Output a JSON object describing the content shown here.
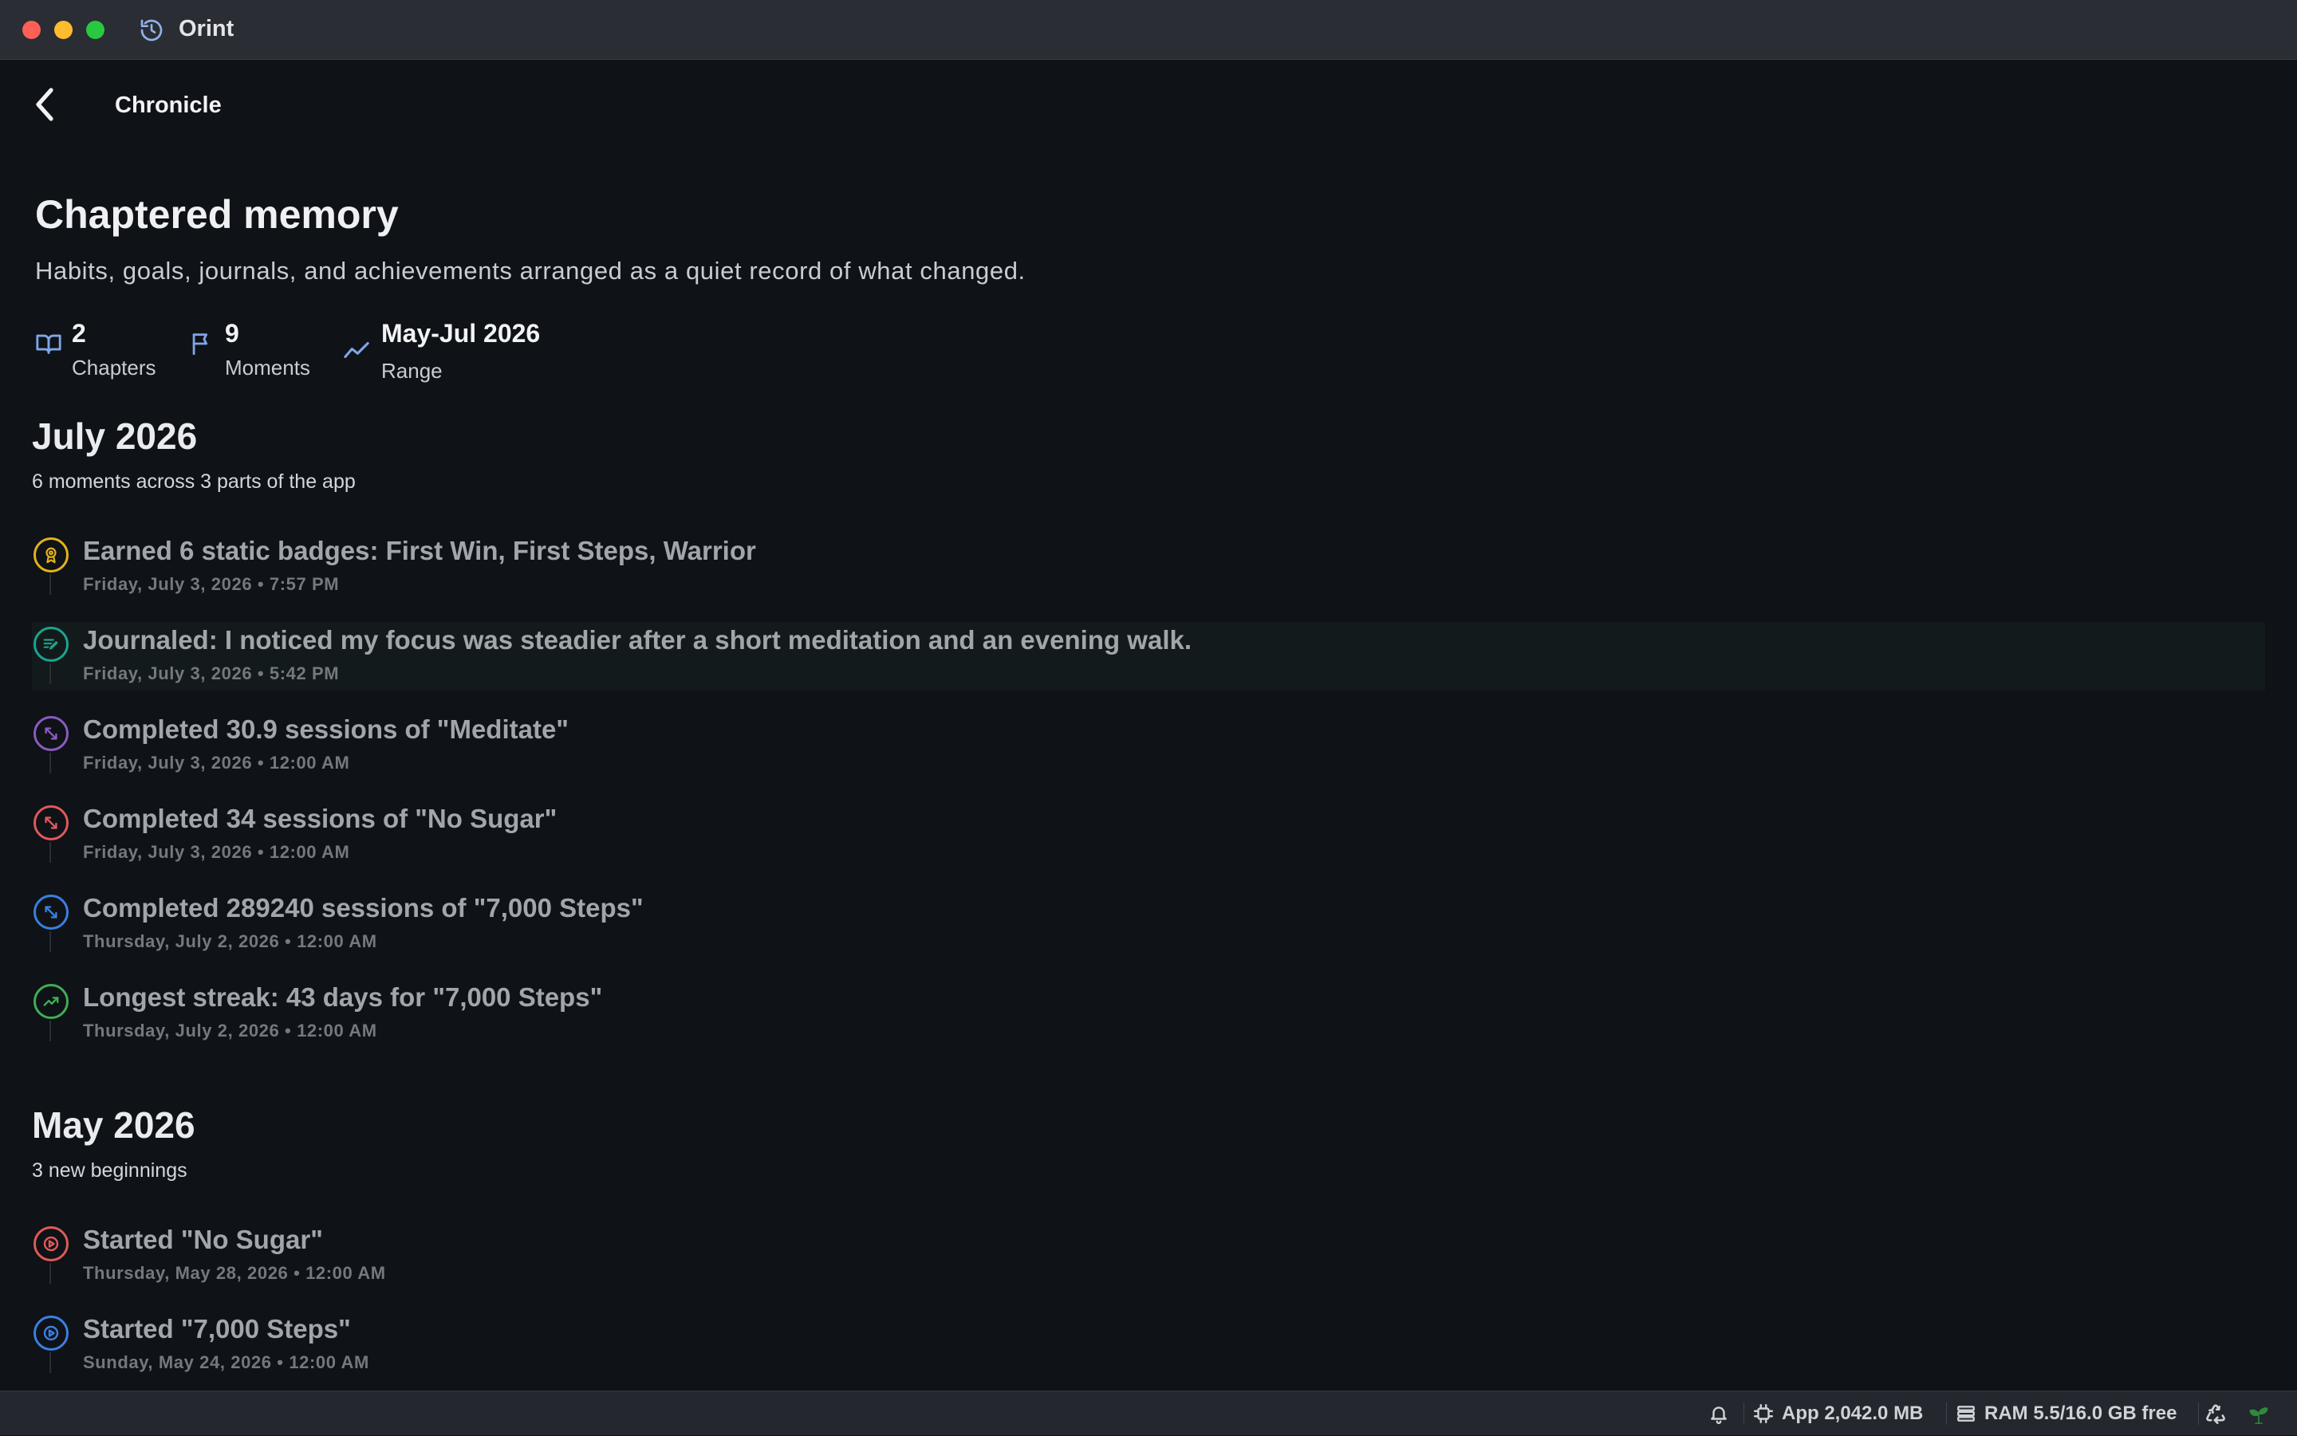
{
  "window": {
    "app_name": "Orint"
  },
  "nav": {
    "title": "Chronicle"
  },
  "header": {
    "title": "Chaptered memory",
    "subtitle": "Habits, goals, journals, and achievements arranged as a quiet record of what changed."
  },
  "stats": [
    {
      "value": "2",
      "label": "Chapters",
      "icon": "book-open-icon"
    },
    {
      "value": "9",
      "label": "Moments",
      "icon": "flag-icon"
    },
    {
      "value": "May-Jul 2026",
      "label": "Range",
      "icon": "trend-line-icon"
    }
  ],
  "sections": [
    {
      "title": "July 2026",
      "subtitle": "6 moments across 3 parts of the app",
      "events": [
        {
          "title": "Earned 6 static badges: First Win, First Steps, Warrior",
          "time": "Friday, July 3, 2026 • 7:57 PM",
          "icon": "badge-icon",
          "color": "#e3b21c"
        },
        {
          "title": "Journaled: I noticed my focus was steadier after a short meditation and an evening walk.",
          "time": "Friday, July 3, 2026 • 5:42 PM",
          "icon": "journal-edit-icon",
          "color": "#1aa58f"
        },
        {
          "title": "Completed 30.9 sessions of \"Meditate\"",
          "time": "Friday, July 3, 2026 • 12:00 AM",
          "icon": "expand-arrows-icon",
          "color": "#8a5bbf"
        },
        {
          "title": "Completed 34 sessions of \"No Sugar\"",
          "time": "Friday, July 3, 2026 • 12:00 AM",
          "icon": "expand-arrows-icon",
          "color": "#e0595a"
        },
        {
          "title": "Completed 289240 sessions of \"7,000 Steps\"",
          "time": "Thursday, July 2, 2026 • 12:00 AM",
          "icon": "expand-arrows-icon",
          "color": "#3a7fe0"
        },
        {
          "title": "Longest streak: 43 days for \"7,000 Steps\"",
          "time": "Thursday, July 2, 2026 • 12:00 AM",
          "icon": "trend-up-icon",
          "color": "#3fae55"
        }
      ]
    },
    {
      "title": "May 2026",
      "subtitle": "3 new beginnings",
      "events": [
        {
          "title": "Started \"No Sugar\"",
          "time": "Thursday, May 28, 2026 • 12:00 AM",
          "icon": "play-circle-icon",
          "color": "#e0595a"
        },
        {
          "title": "Started \"7,000 Steps\"",
          "time": "Sunday, May 24, 2026 • 12:00 AM",
          "icon": "play-circle-icon",
          "color": "#3a7fe0"
        }
      ]
    }
  ],
  "statusbar": {
    "app_memory": "App 2,042.0 MB",
    "ram": "RAM 5.5/16.0 GB free"
  }
}
